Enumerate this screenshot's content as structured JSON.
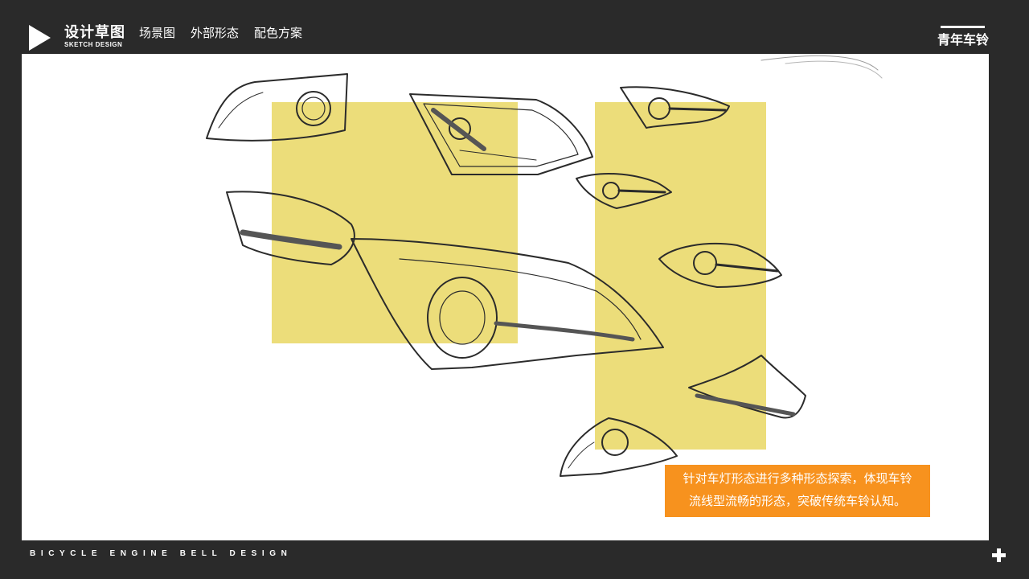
{
  "header": {
    "logo_title": "设计草图",
    "logo_subtitle": "SKETCH DESIGN",
    "nav": [
      {
        "label": "场景图"
      },
      {
        "label": "外部形态"
      },
      {
        "label": "配色方案"
      }
    ],
    "brand": "青年车铃"
  },
  "main": {
    "caption_line1": "针对车灯形态进行多种形态探索，体现车铃",
    "caption_line2": "流线型流畅的形态，突破传统车铃认知。"
  },
  "footer": {
    "text": "BICYCLE ENGINE BELL DESIGN"
  },
  "colors": {
    "background": "#2a2a2a",
    "accent": "#f7921e",
    "highlight": "#ecdd7a"
  },
  "icons": [
    "play-icon",
    "plus-icon"
  ]
}
